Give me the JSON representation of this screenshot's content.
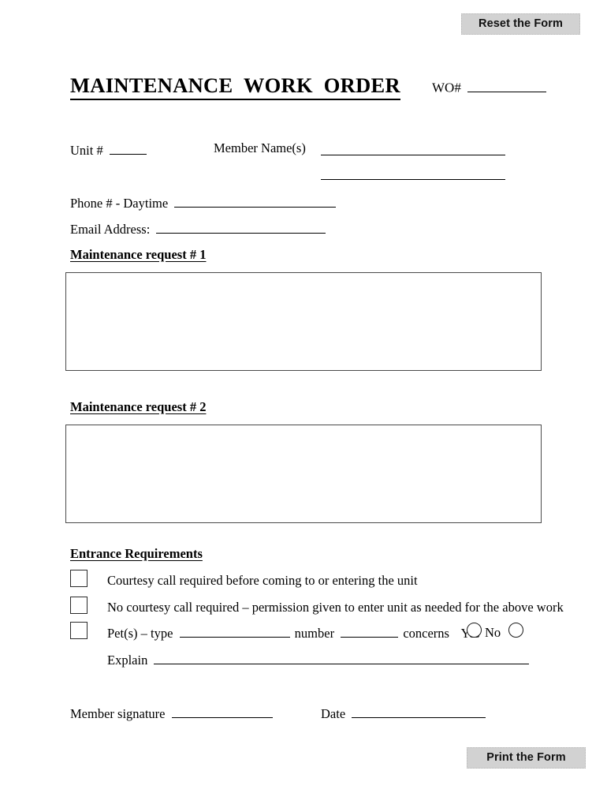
{
  "buttons": {
    "reset_label": "Reset the Form",
    "print_label": "Print the Form"
  },
  "header": {
    "title": "MAINTENANCE  WORK  ORDER",
    "wo_label": "WO#",
    "wo_blank": "_________"
  },
  "fields": {
    "unit_label": "Unit #",
    "unit_blank": "_____",
    "member_name_label": "Member Name(s)",
    "phone_label": "Phone # - Daytime",
    "email_label": "Email Address:"
  },
  "sections": {
    "request_1_heading": "Maintenance request # 1",
    "request_2_heading": "Maintenance request # 2",
    "entrance_heading": "Entrance Requirements"
  },
  "requests": {
    "request_1_value": "",
    "request_2_value": ""
  },
  "entrance": {
    "options": [
      {
        "label": "Courtesy call required before coming to or entering the unit"
      },
      {
        "label": "No courtesy call required – permission given to enter unit as needed for the above work"
      }
    ],
    "pet": {
      "prefix": "Pet(s) – type",
      "number_label": "number",
      "concerns_label": "concerns",
      "yes_label": "Yes",
      "no_label": "No"
    },
    "explain_label": "Explain"
  },
  "signature": {
    "member_signature_label": "Member signature",
    "date_label": "Date"
  },
  "colors": {
    "button_face": "#d2d2d2",
    "box_border": "#4a4a4a",
    "rule": "#000000",
    "page": "#ffffff"
  }
}
